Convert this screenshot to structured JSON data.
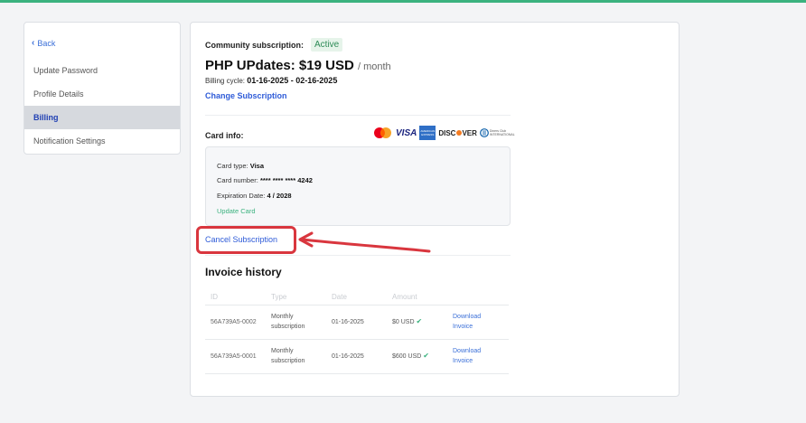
{
  "sidebar": {
    "back_label": "Back",
    "items": [
      {
        "label": "Update Password",
        "active": false
      },
      {
        "label": "Profile Details",
        "active": false
      },
      {
        "label": "Billing",
        "active": true
      },
      {
        "label": "Notification Settings",
        "active": false
      }
    ]
  },
  "subscription": {
    "label": "Community subscription:",
    "status": "Active",
    "plan_name": "PHP UPdates: $19 USD",
    "period": "/ month",
    "cycle_label": "Billing cycle:",
    "cycle_range": "01-16-2025 - 02-16-2025",
    "change_label": "Change Subscription"
  },
  "card_info": {
    "label": "Card info:",
    "brands": [
      "Mastercard",
      "VISA",
      "American Express",
      "DISCOVER",
      "Diners Club"
    ],
    "amex_text": [
      "AMERICAN",
      "EXPRESS"
    ],
    "diners_text": [
      "Diners Club",
      "INTERNATIONAL"
    ],
    "type_label": "Card type:",
    "type_value": "Visa",
    "number_label": "Card number:",
    "number_value": "**** **** **** 4242",
    "expiry_label": "Expiration Date:",
    "expiry_value": "4 / 2028",
    "update_label": "Update Card"
  },
  "cancel_label": "Cancel Subscription",
  "invoices": {
    "title": "Invoice history",
    "columns": [
      "ID",
      "Type",
      "Date",
      "Amount",
      ""
    ],
    "rows": [
      {
        "id": "56A739A5-0002",
        "type": [
          "Monthly",
          "subscription"
        ],
        "date": "01-16-2025",
        "amount": "$0 USD",
        "download": [
          "Download",
          "Invoice"
        ]
      },
      {
        "id": "56A739A5-0001",
        "type": [
          "Monthly",
          "subscription"
        ],
        "date": "01-16-2025",
        "amount": "$600 USD",
        "download": [
          "Download",
          "Invoice"
        ]
      }
    ]
  },
  "colors": {
    "accent_green": "#3bb27f",
    "link_blue": "#2e5bd8",
    "annotation_red": "#d9363e"
  }
}
